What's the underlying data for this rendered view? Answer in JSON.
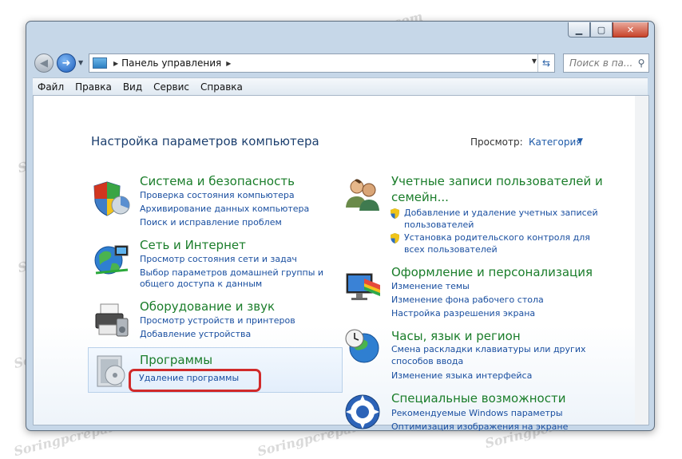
{
  "address": {
    "breadcrumb": "Панель управления"
  },
  "search": {
    "placeholder": "Поиск в па..."
  },
  "menu": [
    "Файл",
    "Правка",
    "Вид",
    "Сервис",
    "Справка"
  ],
  "page": {
    "title": "Настройка параметров компьютера"
  },
  "view": {
    "label": "Просмотр:",
    "value": "Категория"
  },
  "categories": {
    "system": {
      "title": "Система и безопасность",
      "links": [
        "Проверка состояния компьютера",
        "Архивирование данных компьютера",
        "Поиск и исправление проблем"
      ]
    },
    "network": {
      "title": "Сеть и Интернет",
      "links": [
        "Просмотр состояния сети и задач",
        "Выбор параметров домашней группы и",
        "общего доступа к данным"
      ]
    },
    "hardware": {
      "title": "Оборудование и звук",
      "links": [
        "Просмотр устройств и принтеров",
        "Добавление устройства"
      ]
    },
    "programs": {
      "title": "Программы",
      "links": [
        "Удаление программы"
      ]
    },
    "accounts": {
      "title_line1": "Учетные записи пользователей и",
      "title_line2": "семейн...",
      "links": [
        "Добавление и удаление учетных записей",
        "пользователей",
        "Установка родительского контроля для",
        "всех пользователей"
      ]
    },
    "appearance": {
      "title": "Оформление и персонализация",
      "links": [
        "Изменение темы",
        "Изменение фона рабочего стола",
        "Настройка разрешения экрана"
      ]
    },
    "clock": {
      "title": "Часы, язык и регион",
      "links": [
        "Смена раскладки клавиатуры или других",
        "способов ввода",
        "Изменение языка интерфейса"
      ]
    },
    "access": {
      "title": "Специальные возможности",
      "links": [
        "Рекомендуемые Windows параметры",
        "Оптимизация изображения на экране"
      ]
    }
  },
  "watermark": "Soringpcrepair.com",
  "colors": {
    "link": "#1a4fa0",
    "category_title": "#1a7d2a",
    "highlight": "#d12a2a"
  }
}
